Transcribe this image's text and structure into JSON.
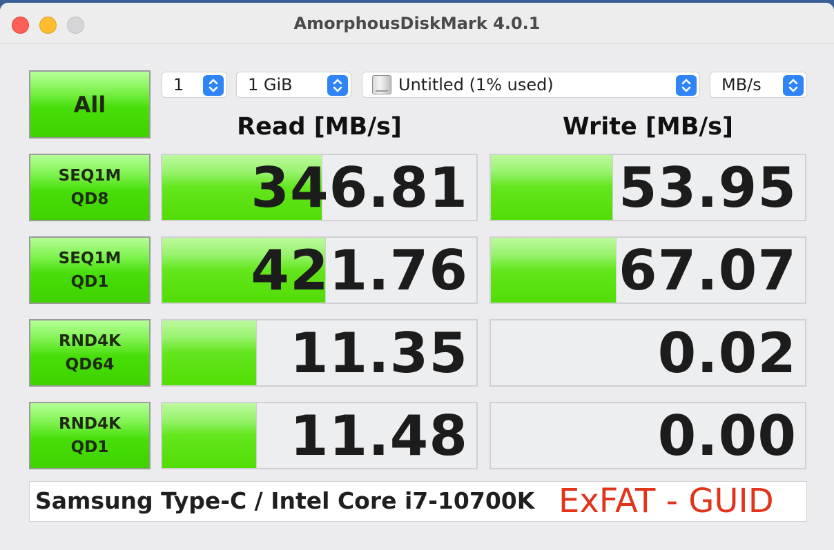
{
  "window": {
    "title": "AmorphousDiskMark 4.0.1"
  },
  "controls": {
    "all_label": "All",
    "count": "1",
    "size": "1 GiB",
    "drive": "Untitled (1% used)",
    "unit": "MB/s"
  },
  "headers": {
    "read": "Read [MB/s]",
    "write": "Write [MB/s]"
  },
  "tests": [
    {
      "line1": "SEQ1M",
      "line2": "QD8",
      "read": "346.81",
      "write": "53.95",
      "read_fill_pct": 51,
      "write_fill_pct": 39
    },
    {
      "line1": "SEQ1M",
      "line2": "QD1",
      "read": "421.76",
      "write": "67.07",
      "read_fill_pct": 52,
      "write_fill_pct": 40
    },
    {
      "line1": "RND4K",
      "line2": "QD64",
      "read": "11.35",
      "write": "0.02",
      "read_fill_pct": 30,
      "write_fill_pct": 0
    },
    {
      "line1": "RND4K",
      "line2": "QD1",
      "read": "11.48",
      "write": "0.00",
      "read_fill_pct": 30,
      "write_fill_pct": 0
    }
  ],
  "comment": {
    "text": "Samsung Type-C / Intel Core i7-10700K",
    "filesystem": "ExFAT - GUID"
  },
  "colors": {
    "bar_green": "#52dd05",
    "accent_blue": "#2f84f6",
    "filesystem_red": "#e2341b"
  }
}
